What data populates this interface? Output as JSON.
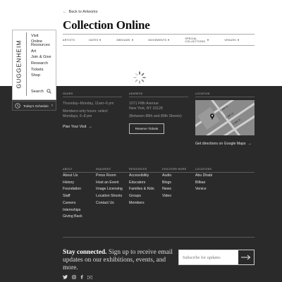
{
  "header": {
    "back_link": "Back to Artworks",
    "title": "Collection Online",
    "filters": [
      {
        "label": "ARTISTS",
        "has_caret": false
      },
      {
        "label": "DATES",
        "has_caret": true
      },
      {
        "label": "MEDIUMS",
        "has_caret": true
      },
      {
        "label": "MOVEMENTS",
        "has_caret": true
      },
      {
        "label": "SPECIAL COLLECTIONS",
        "has_caret": true
      },
      {
        "label": "VENUES",
        "has_caret": true
      }
    ]
  },
  "sidebar": {
    "logo": "GUGGENHEIM",
    "items": [
      "Visit",
      "Online Resources",
      "Art",
      "Join & Give",
      "Research",
      "Tickets",
      "Shop"
    ],
    "search_label": "Search",
    "schedule_label": "Today's Schedule"
  },
  "info": {
    "hours_header": "HOURS",
    "hours_lines": [
      "Thursday–Monday, 11am–6 pm",
      "",
      "Members-only hours: select",
      "Mondays, 6–8 pm"
    ],
    "plan_visit": "Plan Your Visit",
    "address_header": "ADDRESS",
    "address_lines": [
      "1071 Fifth Avenue",
      "New York, NY 10128",
      "(Between 88th and 89th Streets)"
    ],
    "reserve_tickets": "Reserve Tickets",
    "location_header": "LOCATION",
    "map_streets": [
      "E 90th St",
      "E 89th St",
      "E 88th St"
    ],
    "directions": "Get directions on Google Maps"
  },
  "footer_columns": [
    {
      "header": "ABOUT",
      "items": [
        "About Us",
        "History",
        "Foundation",
        "Staff",
        "Careers",
        "Internships",
        "Giving Back"
      ]
    },
    {
      "header": "INQUIRIES",
      "items": [
        "Press Room",
        "Host an Event",
        "Image Licensing",
        "Location Shoots",
        "Contact Us"
      ]
    },
    {
      "header": "RESOURCES",
      "items": [
        "Accessibility",
        "Educators",
        "Families & Kids",
        "Groups",
        "Members"
      ]
    },
    {
      "header": "DISCOVER MORE",
      "items": [
        "Audio",
        "Blogs",
        "News",
        "Video"
      ]
    },
    {
      "header": "LOCATIONS",
      "items": [
        "Abu Dhabi",
        "Bilbao",
        "Venice"
      ]
    }
  ],
  "newsletter": {
    "headline": "Stay connected.",
    "body": "Sign up to receive email updates on our exhibitions, events, and more.",
    "placeholder": "Subscribe for updates"
  },
  "socials": [
    "twitter-icon",
    "instagram-icon",
    "facebook-icon",
    "youtube-icon"
  ],
  "colors": {
    "dark_bg": "#2b2a2a",
    "text_light": "#e2e2e2",
    "text_muted": "#9a9a9a"
  }
}
